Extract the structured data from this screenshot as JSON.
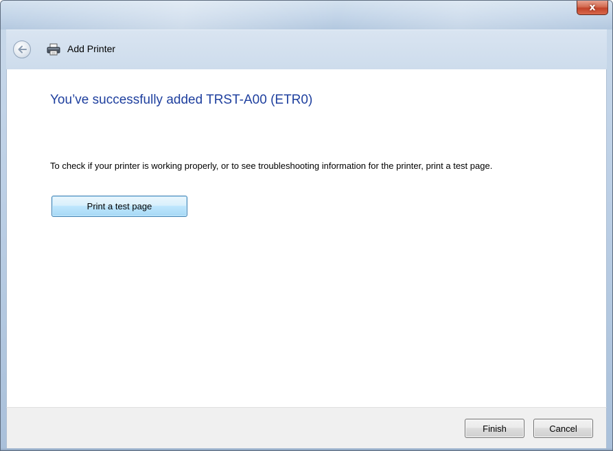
{
  "window": {
    "close_icon": "close-icon",
    "close_glyph": "x"
  },
  "nav": {
    "back_icon": "back-arrow-icon",
    "app_icon": "printer-icon",
    "title": "Add Printer"
  },
  "content": {
    "heading": "You’ve successfully added TRST-A00 (ETR0)",
    "info_text": "To check if your printer is working properly, or to see troubleshooting information for the printer, print a test page.",
    "test_button_label": "Print a test page"
  },
  "footer": {
    "finish_label": "Finish",
    "cancel_label": "Cancel"
  },
  "colors": {
    "heading": "#1e3f9e",
    "accent_button": "#bee6fd",
    "close_button": "#c2432a"
  }
}
